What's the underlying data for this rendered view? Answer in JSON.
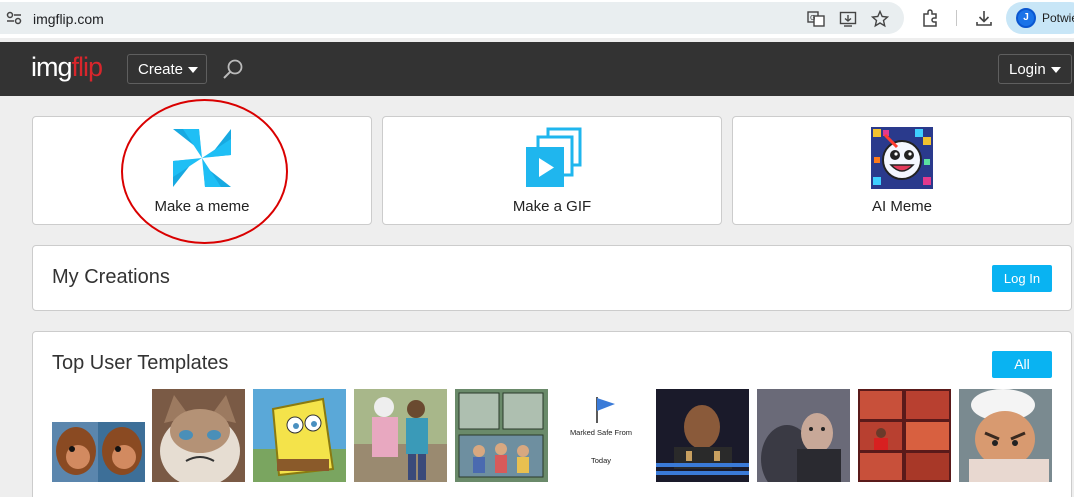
{
  "browser": {
    "url": "imgflip.com",
    "profile_name": "Potwie",
    "profile_initial": "J"
  },
  "header": {
    "logo_img": "img",
    "logo_flip": "flip",
    "create_label": "Create",
    "login_label": "Login"
  },
  "cards": [
    {
      "label": "Make a meme",
      "icon": "pinwheel-icon"
    },
    {
      "label": "Make a GIF",
      "icon": "gif-stack-icon"
    },
    {
      "label": "AI Meme",
      "icon": "ai-meme-icon"
    }
  ],
  "my_creations": {
    "title": "My Creations",
    "login_button": "Log In"
  },
  "templates": {
    "title": "Top User Templates",
    "all_button": "All",
    "marked_safe_line1": "Marked Safe From",
    "marked_safe_line2": "Today"
  },
  "colors": {
    "accent": "#09b3f2",
    "brand_red": "#d9262c",
    "header_bg": "#333333",
    "annotation_red": "#d90000"
  }
}
